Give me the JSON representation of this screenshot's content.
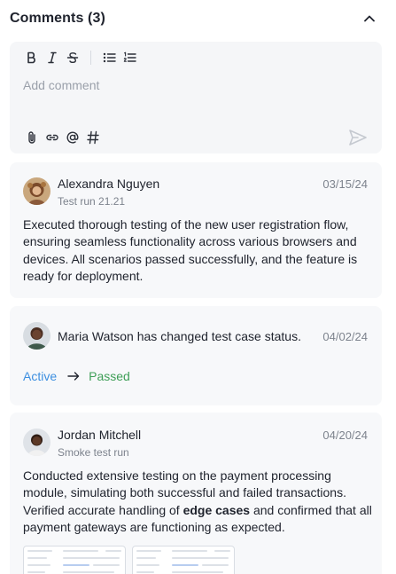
{
  "header": {
    "title": "Comments (3)",
    "collapse_icon": "chevron-up-icon"
  },
  "editor": {
    "toolbar": [
      "bold-icon",
      "italic-icon",
      "strikethrough-icon",
      "bullet-list-icon",
      "numbered-list-icon"
    ],
    "placeholder": "Add comment",
    "attachments": [
      "paperclip-icon",
      "link-icon",
      "mention-icon",
      "hashtag-icon"
    ],
    "send_icon": "send-icon"
  },
  "comments": [
    {
      "author": "Alexandra Nguyen",
      "context": "Test run 21.21",
      "date": "03/15/24",
      "text": "Executed thorough testing of the new user registration flow, ensuring seamless functionality across various browsers and devices. All scenarios passed successfully, and the feature is ready for deployment."
    },
    {
      "message": "Maria Watson has changed test case status.",
      "date": "04/02/24",
      "status_from": "Active",
      "status_to": "Passed"
    },
    {
      "author": "Jordan Mitchell",
      "context": "Smoke test run",
      "date": "04/20/24",
      "text_before": "Conducted extensive testing on the payment processing module, simulating both successful and failed transactions. Verified accurate handling of ",
      "text_bold": "edge cases",
      "text_after": " and confirmed that all payment gateways are functioning as expected.",
      "attachments": [
        "screenshot-attachment",
        "screenshot-attachment"
      ]
    }
  ],
  "colors": {
    "status_active": "#3d8fe0",
    "status_passed": "#3f9f58",
    "card_bg": "#f7f8fa"
  }
}
